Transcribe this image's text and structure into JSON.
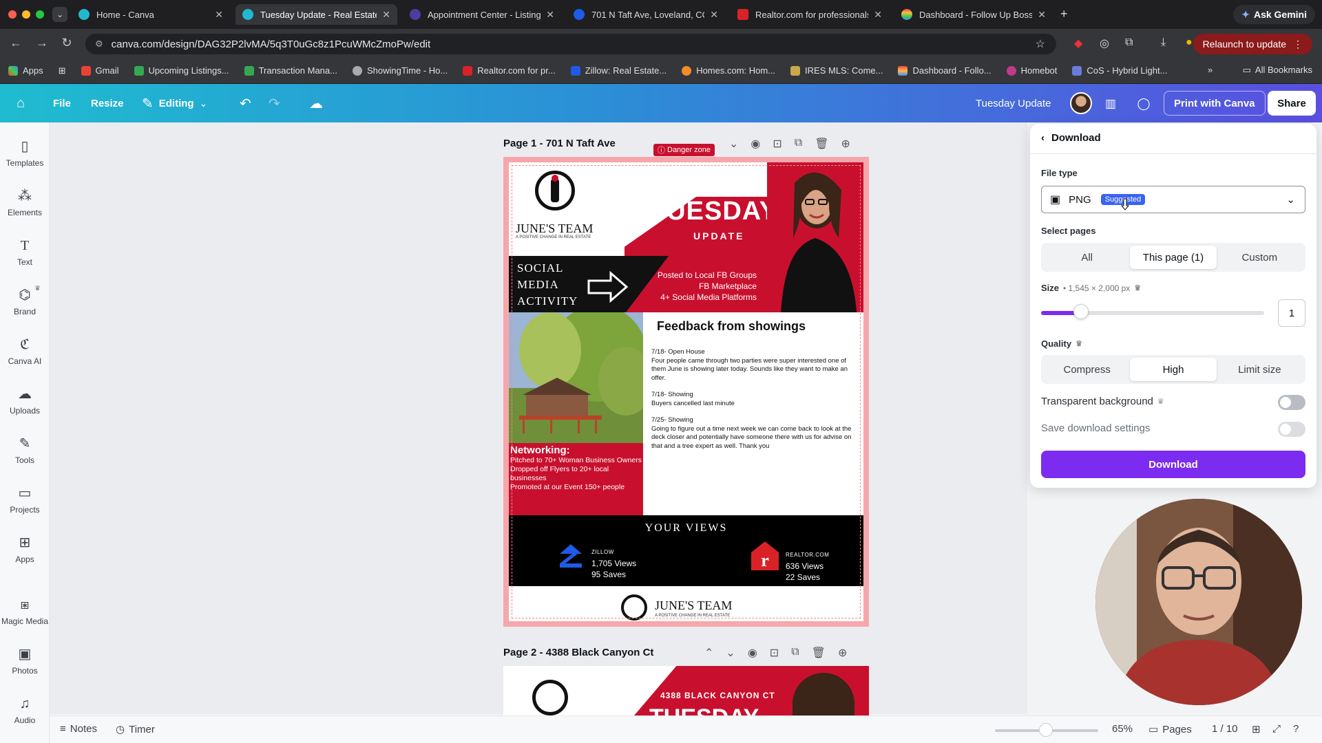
{
  "browser": {
    "tabs": [
      {
        "label": "Home - Canva",
        "active": false
      },
      {
        "label": "Tuesday Update - Real Estate",
        "active": true
      },
      {
        "label": "Appointment Center - Listing",
        "active": false
      },
      {
        "label": "701 N Taft Ave, Loveland, CO",
        "active": false
      },
      {
        "label": "Realtor.com for professionals",
        "active": false
      },
      {
        "label": "Dashboard - Follow Up Boss",
        "active": false
      }
    ],
    "ask_gemini": "Ask Gemini",
    "url": "canva.com/design/DAG32P2lvMA/5q3T0uGc8z1PcuWMcZmoPw/edit",
    "relaunch": "Relaunch to update",
    "bookmarks": [
      {
        "label": "Apps"
      },
      {
        "label": "Gmail"
      },
      {
        "label": "Upcoming Listings..."
      },
      {
        "label": "Transaction Mana..."
      },
      {
        "label": "ShowingTime - Ho..."
      },
      {
        "label": "Realtor.com for pr..."
      },
      {
        "label": "Zillow: Real Estate..."
      },
      {
        "label": "Homes.com: Hom..."
      },
      {
        "label": "IRES MLS: Come..."
      },
      {
        "label": "Dashboard - Follo..."
      },
      {
        "label": "Homebot"
      },
      {
        "label": "CoS - Hybrid Light..."
      }
    ],
    "all_bookmarks": "All Bookmarks"
  },
  "header": {
    "file": "File",
    "resize": "Resize",
    "editing": "Editing",
    "design_title": "Tuesday Update",
    "print": "Print with Canva",
    "share": "Share"
  },
  "leftrail": [
    {
      "label": "Templates",
      "icon": "templates-icon"
    },
    {
      "label": "Elements",
      "icon": "elements-icon"
    },
    {
      "label": "Text",
      "icon": "text-icon"
    },
    {
      "label": "Brand",
      "icon": "brand-icon"
    },
    {
      "label": "Canva AI",
      "icon": "canva-ai-icon"
    },
    {
      "label": "Uploads",
      "icon": "uploads-icon"
    },
    {
      "label": "Tools",
      "icon": "tools-icon"
    },
    {
      "label": "Projects",
      "icon": "projects-icon"
    },
    {
      "label": "Apps",
      "icon": "apps-icon"
    },
    {
      "label": "Magic Media",
      "icon": "magic-media-icon"
    },
    {
      "label": "Photos",
      "icon": "photos-icon"
    },
    {
      "label": "Audio",
      "icon": "audio-icon"
    }
  ],
  "canvas": {
    "page1_title": "Page 1 - 701 N Taft Ave",
    "danger_zone": "Danger zone",
    "page2_title": "Page 2 - 4388 Black Canyon Ct"
  },
  "design": {
    "team_name": "JUNE'S TEAM",
    "tagline": "A POSITIVE CHANGE IN REAL ESTATE",
    "tuesday": "TUESDAY",
    "update": "UPDATE",
    "social": [
      "SOCIAL",
      "MEDIA",
      "ACTIVITY"
    ],
    "posted": [
      "Posted to Local FB Groups",
      "FB Marketplace",
      "4+ Social Media Platforms"
    ],
    "networking_title": "Networking:",
    "networking_lines": [
      "Pitched to 70+ Woman Business Owners",
      "Dropped off Flyers to 20+ local businesses",
      "Promoted at our Event 150+ people"
    ],
    "feedback_title": "Feedback from showings",
    "feedback": [
      {
        "head": "7/18- Open House",
        "body": "Four people came through two parties were super interested one of them June is showing later today. Sounds like they want to make an offer."
      },
      {
        "head": "7/18- Showing",
        "body": "Buyers cancelled last minute"
      },
      {
        "head": "7/25- Showing",
        "body": "Going to figure out a time next week we can come back to look at the deck closer and potentially have someone there with us for advise on that and a tree expert as well. Thank you"
      }
    ],
    "views_title": "YOUR VIEWS",
    "zillow": {
      "name": "ZILLOW",
      "views": "1,705 Views",
      "saves": "95 Saves"
    },
    "realtor": {
      "name": "REALTOR.COM",
      "views": "636 Views",
      "saves": "22 Saves"
    },
    "page2_banner": "4388 BLACK CANYON CT",
    "page2_tuesday": "TUESDAY"
  },
  "download_panel": {
    "title": "Download",
    "file_type_label": "File type",
    "file_type": "PNG",
    "suggested": "Suggested",
    "select_pages_label": "Select pages",
    "pages_options": [
      "All",
      "This page (1)",
      "Custom"
    ],
    "pages_selected": "This page (1)",
    "size_label": "Size",
    "size_value": "• 1,545 × 2,000 px",
    "size_scale": "1",
    "size_slider_fraction": 0.18,
    "quality_label": "Quality",
    "quality_options": [
      "Compress",
      "High",
      "Limit size"
    ],
    "quality_selected": "High",
    "transparent_bg": "Transparent background",
    "save_settings": "Save download settings",
    "download_button": "Download"
  },
  "bottombar": {
    "notes": "Notes",
    "timer": "Timer",
    "zoom": "65%",
    "pages": "Pages",
    "page_count": "1 / 10"
  },
  "colors": {
    "canva_purple": "#7b2cf0",
    "design_red": "#c8102e",
    "suggested_blue": "#3a64f0"
  }
}
